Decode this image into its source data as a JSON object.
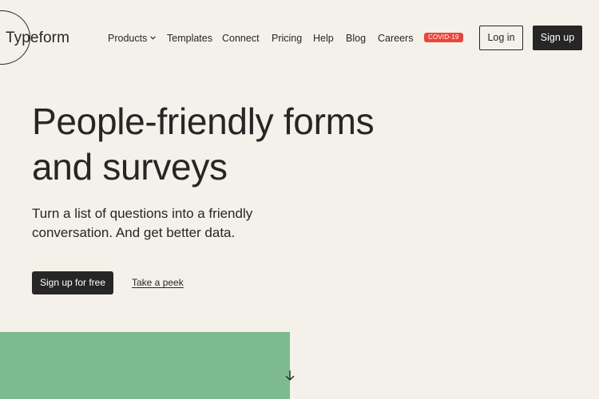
{
  "header": {
    "logo_text": "Typeform",
    "nav": {
      "products": "Products",
      "templates": "Templates",
      "connect": "Connect",
      "pricing": "Pricing",
      "help": "Help",
      "blog": "Blog",
      "careers": "Careers"
    },
    "covid_badge": "COVID-19",
    "login_label": "Log in",
    "signup_label": "Sign up"
  },
  "hero": {
    "title_line1": "People-friendly forms",
    "title_line2": "and surveys",
    "subtitle_line1": "Turn a list of questions into a friendly",
    "subtitle_line2": "conversation. And get better data.",
    "cta_label": "Sign up for free",
    "peek_label": "Take a peek"
  },
  "icons": {
    "products_dropdown": "chevron-down-icon",
    "scroll": "arrow-down-icon"
  },
  "colors": {
    "background": "#f4f1ea",
    "text": "#262626",
    "badge": "#e8453c",
    "panel": "#7dbb8f"
  }
}
